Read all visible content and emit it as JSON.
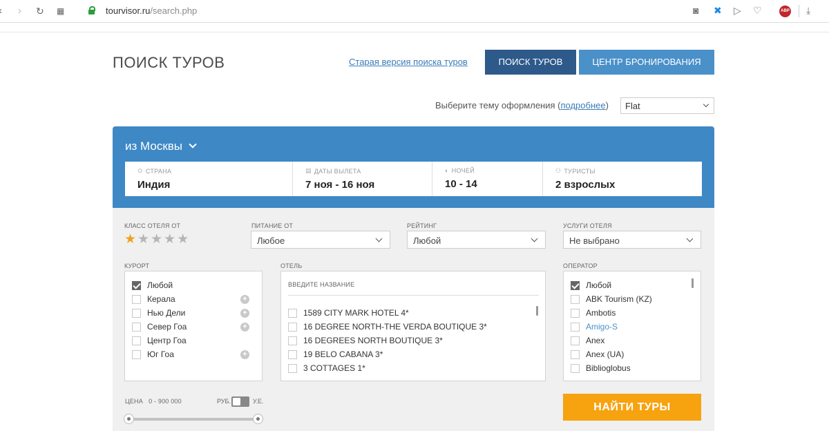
{
  "browser": {
    "url_host": "tourvisor.ru",
    "url_path": "/search.php",
    "abp_label": "ABP"
  },
  "header": {
    "title": "ПОИСК ТУРОВ",
    "old_version_link": "Старая версия поиска туров",
    "tab_search": "ПОИСК ТУРОВ",
    "tab_booking": "ЦЕНТР БРОНИРОВАНИЯ"
  },
  "theme": {
    "label_before": "Выберите тему оформления (",
    "link": "подробнее",
    "label_after": ")",
    "value": "Flat"
  },
  "search": {
    "departure": "из Москвы",
    "fields": [
      {
        "caption": "СТРАНА",
        "value": "Индия",
        "icon": "pin-icon"
      },
      {
        "caption": "ДАТЫ ВЫЛЕТА",
        "value": "7 ноя - 16 ноя",
        "icon": "calendar-icon"
      },
      {
        "caption": "НОЧЕЙ",
        "value": "10 - 14",
        "icon": "moon-icon"
      },
      {
        "caption": "ТУРИСТЫ",
        "value": "2 взрослых",
        "icon": "person-icon"
      }
    ]
  },
  "filters": {
    "hotel_class_label": "КЛАСС ОТЕЛЯ ОТ",
    "hotel_class_value": 1,
    "hotel_class_max": 5,
    "meal_label": "ПИТАНИЕ ОТ",
    "meal_value": "Любое",
    "rating_label": "РЕЙТИНГ",
    "rating_value": "Любой",
    "services_label": "УСЛУГИ ОТЕЛЯ",
    "services_value": "Не выбрано"
  },
  "resort": {
    "label": "КУРОРТ",
    "items": [
      {
        "label": "Любой",
        "checked": true,
        "plus": false
      },
      {
        "label": "Керала",
        "checked": false,
        "plus": true
      },
      {
        "label": "Нью Дели",
        "checked": false,
        "plus": true
      },
      {
        "label": "Север Гоа",
        "checked": false,
        "plus": true
      },
      {
        "label": "Центр Гоа",
        "checked": false,
        "plus": false
      },
      {
        "label": "Юг Гоа",
        "checked": false,
        "plus": true
      }
    ]
  },
  "hotel": {
    "label": "ОТЕЛЬ",
    "search_hint": "ВВЕДИТЕ НАЗВАНИЕ",
    "items": [
      "1589 CITY MARK HOTEL 4*",
      "16 DEGREE NORTH-THE VERDA BOUTIQUE 3*",
      "16 DEGREES NORTH BOUTIQUE 3*",
      "19 BELO CABANA 3*",
      "3 COTTAGES 1*"
    ]
  },
  "operator": {
    "label": "ОПЕРАТОР",
    "items": [
      {
        "label": "Любой",
        "checked": true,
        "highlight": false
      },
      {
        "label": "ABK Tourism (KZ)",
        "checked": false,
        "highlight": false
      },
      {
        "label": "Ambotis",
        "checked": false,
        "highlight": false
      },
      {
        "label": "Amigo-S",
        "checked": false,
        "highlight": true
      },
      {
        "label": "Anex",
        "checked": false,
        "highlight": false
      },
      {
        "label": "Anex (UA)",
        "checked": false,
        "highlight": false
      },
      {
        "label": "Biblioglobus",
        "checked": false,
        "highlight": false
      }
    ],
    "highlight_color": "#4a90c9"
  },
  "price": {
    "label": "ЦЕНА",
    "range": "0  -  900 000",
    "currency_rub": "РУБ.",
    "currency_ue": "У.Е."
  },
  "find_button": "НАЙТИ ТУРЫ",
  "colors": {
    "header_blue": "#3e88c6",
    "tab_active": "#2d5a8a",
    "tab_inactive": "#4a90c9",
    "find_orange": "#f7a20f",
    "star_on": "#f0a21b"
  }
}
